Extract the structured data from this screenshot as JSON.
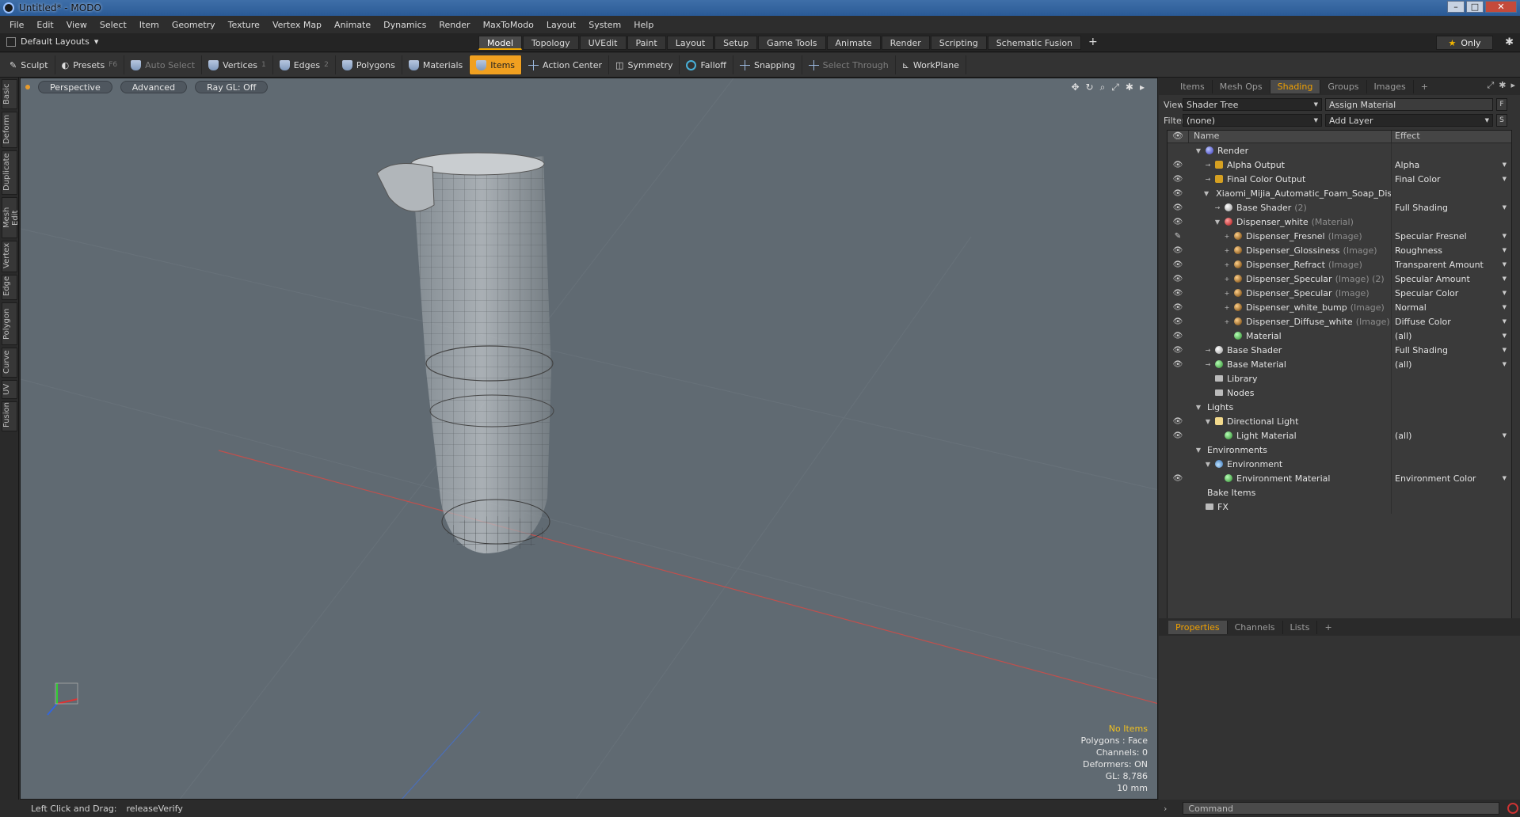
{
  "window": {
    "title": "Untitled* - MODO"
  },
  "menu": [
    "File",
    "Edit",
    "View",
    "Select",
    "Item",
    "Geometry",
    "Texture",
    "Vertex Map",
    "Animate",
    "Dynamics",
    "Render",
    "MaxToModo",
    "Layout",
    "System",
    "Help"
  ],
  "layoutbar": {
    "layout_name": "Default Layouts",
    "tabs": [
      "Model",
      "Topology",
      "UVEdit",
      "Paint",
      "Layout",
      "Setup",
      "Game Tools",
      "Animate",
      "Render",
      "Scripting",
      "Schematic Fusion"
    ],
    "active_tab": "Model",
    "plus": "+",
    "only": "Only"
  },
  "toolbar": {
    "sculpt": "Sculpt",
    "presets": "Presets",
    "presets_key": "F6",
    "auto_select": "Auto Select",
    "vertices": "Vertices",
    "vertices_key": "1",
    "edges": "Edges",
    "edges_key": "2",
    "polygons": "Polygons",
    "materials": "Materials",
    "items": "Items",
    "action_center": "Action Center",
    "symmetry": "Symmetry",
    "falloff": "Falloff",
    "snapping": "Snapping",
    "select_through": "Select Through",
    "workplane": "WorkPlane"
  },
  "left_tabs": [
    "Basic",
    "Deform",
    "Duplicate",
    "Mesh Edit",
    "Vertex",
    "Edge",
    "Polygon",
    "Curve",
    "UV",
    "Fusion"
  ],
  "viewport": {
    "view": "Perspective",
    "shading": "Advanced",
    "raygl": "Ray GL: Off",
    "info": {
      "items": "No Items",
      "polygons": "Polygons : Face",
      "channels": "Channels: 0",
      "deformers": "Deformers: ON",
      "gl": "GL: 8,786",
      "scale": "10 mm"
    }
  },
  "status": {
    "hint": "Left Click and Drag:",
    "action": "releaseVerify"
  },
  "right_panel": {
    "tabs": [
      "Items",
      "Mesh Ops",
      "Shading",
      "Groups",
      "Images"
    ],
    "active_tab": "Shading",
    "plus": "+",
    "view_label": "View",
    "view_value": "Shader Tree",
    "assign_material": "Assign Material",
    "f_btn": "F",
    "filter_label": "Filter",
    "filter_value": "(none)",
    "add_layer": "Add Layer",
    "s_btn": "S",
    "col_name": "Name",
    "col_effect": "Effect",
    "rows": [
      {
        "indent": 0,
        "tw": "▼",
        "eye": "",
        "icon": "d-render",
        "name": "Render",
        "sub": "",
        "effect": "",
        "dd": false
      },
      {
        "indent": 1,
        "tw": "→",
        "eye": "👁",
        "icon": "d-out",
        "name": "Alpha Output",
        "sub": "",
        "effect": "Alpha",
        "dd": true
      },
      {
        "indent": 1,
        "tw": "→",
        "eye": "👁",
        "icon": "d-out",
        "name": "Final Color Output",
        "sub": "",
        "effect": "Final Color",
        "dd": true
      },
      {
        "indent": 1,
        "tw": "▼",
        "eye": "👁",
        "icon": "d-mat",
        "name": "Xiaomi_Mijia_Automatic_Foam_Soap_Disp ...",
        "sub": "",
        "effect": "",
        "dd": false
      },
      {
        "indent": 2,
        "tw": "→",
        "eye": "👁",
        "icon": "d-white",
        "name": "Base Shader",
        "sub": "(2)",
        "effect": "Full Shading",
        "dd": true
      },
      {
        "indent": 2,
        "tw": "▼",
        "eye": "👁",
        "icon": "d-mat",
        "name": "Dispenser_white",
        "sub": "(Material)",
        "effect": "",
        "dd": false
      },
      {
        "indent": 3,
        "tw": "+",
        "eye": "✎",
        "icon": "d-img",
        "name": "Dispenser_Fresnel",
        "sub": "(Image)",
        "effect": "Specular Fresnel",
        "dd": true
      },
      {
        "indent": 3,
        "tw": "+",
        "eye": "👁",
        "icon": "d-img",
        "name": "Dispenser_Glossiness",
        "sub": "(Image)",
        "effect": "Roughness",
        "dd": true
      },
      {
        "indent": 3,
        "tw": "+",
        "eye": "👁",
        "icon": "d-img",
        "name": "Dispenser_Refract",
        "sub": "(Image)",
        "effect": "Transparent Amount",
        "dd": true
      },
      {
        "indent": 3,
        "tw": "+",
        "eye": "👁",
        "icon": "d-img",
        "name": "Dispenser_Specular",
        "sub": "(Image) (2)",
        "effect": "Specular Amount",
        "dd": true
      },
      {
        "indent": 3,
        "tw": "+",
        "eye": "👁",
        "icon": "d-img",
        "name": "Dispenser_Specular",
        "sub": "(Image)",
        "effect": "Specular Color",
        "dd": true
      },
      {
        "indent": 3,
        "tw": "+",
        "eye": "👁",
        "icon": "d-img",
        "name": "Dispenser_white_bump",
        "sub": "(Image)",
        "effect": "Normal",
        "dd": true
      },
      {
        "indent": 3,
        "tw": "+",
        "eye": "👁",
        "icon": "d-img",
        "name": "Dispenser_Diffuse_white",
        "sub": "(Image)",
        "effect": "Diffuse Color",
        "dd": true
      },
      {
        "indent": 3,
        "tw": "",
        "eye": "👁",
        "icon": "d-green",
        "name": "Material",
        "sub": "",
        "effect": "(all)",
        "dd": true
      },
      {
        "indent": 1,
        "tw": "→",
        "eye": "👁",
        "icon": "d-white",
        "name": "Base Shader",
        "sub": "",
        "effect": "Full Shading",
        "dd": true
      },
      {
        "indent": 1,
        "tw": "→",
        "eye": "👁",
        "icon": "d-green",
        "name": "Base Material",
        "sub": "",
        "effect": "(all)",
        "dd": true
      },
      {
        "indent": 1,
        "tw": "",
        "eye": "",
        "icon": "d-folder",
        "name": "Library",
        "sub": "",
        "effect": "",
        "dd": false
      },
      {
        "indent": 1,
        "tw": "",
        "eye": "",
        "icon": "d-folder",
        "name": "Nodes",
        "sub": "",
        "effect": "",
        "dd": false
      },
      {
        "indent": 0,
        "tw": "▼",
        "eye": "",
        "icon": "",
        "name": "Lights",
        "sub": "",
        "effect": "",
        "dd": false
      },
      {
        "indent": 1,
        "tw": "▼",
        "eye": "👁",
        "icon": "d-light",
        "name": "Directional Light",
        "sub": "",
        "effect": "",
        "dd": false
      },
      {
        "indent": 2,
        "tw": "",
        "eye": "👁",
        "icon": "d-green",
        "name": "Light Material",
        "sub": "",
        "effect": "(all)",
        "dd": true
      },
      {
        "indent": 0,
        "tw": "▼",
        "eye": "",
        "icon": "",
        "name": "Environments",
        "sub": "",
        "effect": "",
        "dd": false
      },
      {
        "indent": 1,
        "tw": "▼",
        "eye": "",
        "icon": "d-env",
        "name": "Environment",
        "sub": "",
        "effect": "",
        "dd": false
      },
      {
        "indent": 2,
        "tw": "",
        "eye": "👁",
        "icon": "d-green",
        "name": "Environment Material",
        "sub": "",
        "effect": "Environment Color",
        "dd": true
      },
      {
        "indent": 0,
        "tw": "",
        "eye": "",
        "icon": "",
        "name": "Bake Items",
        "sub": "",
        "effect": "",
        "dd": false
      },
      {
        "indent": 0,
        "tw": "",
        "eye": "",
        "icon": "d-folder",
        "name": "FX",
        "sub": "",
        "effect": "",
        "dd": false
      }
    ],
    "bottom_tabs": [
      "Properties",
      "Channels",
      "Lists"
    ],
    "bottom_active": "Properties",
    "command_placeholder": "Command"
  }
}
